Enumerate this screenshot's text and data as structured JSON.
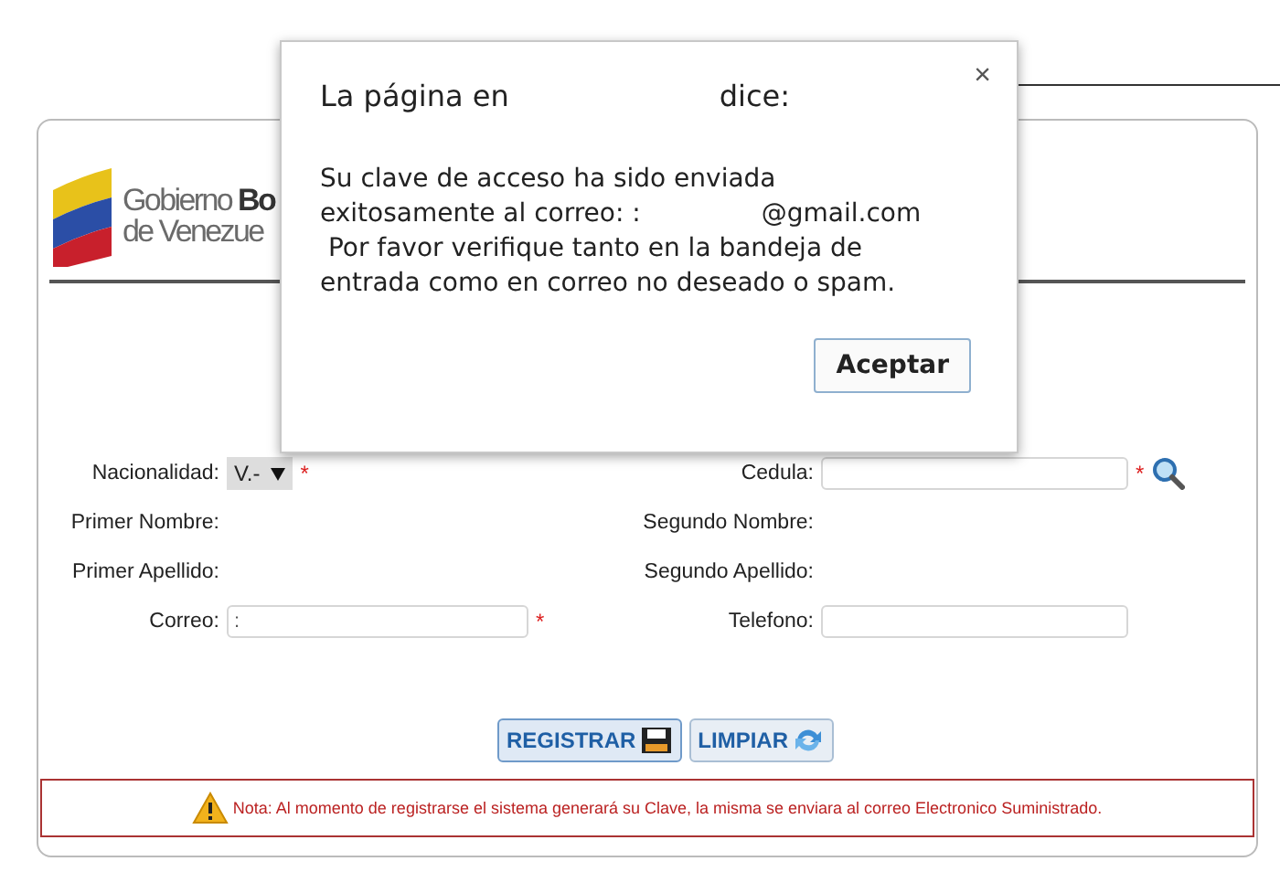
{
  "page": {
    "logo": {
      "line1": "Gobierno **Bo**",
      "line2": "de Venezue"
    }
  },
  "form": {
    "rows": [
      {
        "left": {
          "label": "Nacionalidad:",
          "kind": "select",
          "value": "V.-",
          "marker": "*"
        },
        "right": {
          "label": "Cedula:",
          "kind": "input",
          "marker": "*",
          "search": true
        }
      },
      {
        "left": {
          "label": "Primer Nombre:",
          "kind": "text"
        },
        "right": {
          "label": "Segundo Nombre:",
          "kind": "text"
        }
      },
      {
        "left": {
          "label": "Primer Apellido:",
          "kind": "text"
        },
        "right": {
          "label": "Segundo Apellido:",
          "kind": "text"
        }
      },
      {
        "left": {
          "label": "Correo:",
          "kind": "input",
          "value": ":",
          "marker": "*"
        },
        "right": {
          "label": "Telefono:",
          "kind": "input"
        }
      }
    ],
    "buttons": [
      {
        "label": "REGISTRAR",
        "kind": "save",
        "selected": true
      },
      {
        "label": "LIMPIAR",
        "kind": "refresh",
        "selected": false
      }
    ],
    "note": "Nota: Al momento de registrarse el sistema generará su Clave, la misma se enviara al correo Electronico Suministrado."
  },
  "dialog": {
    "title_start": "La página en",
    "title_end": "dice:",
    "close": "×",
    "message": [
      {
        "text": "Su clave de acceso ha sido enviada"
      },
      {
        "text": "exitosamente al correo: :",
        "suffix": "@gmail.com"
      },
      {
        "text": " Por favor verifique tanto en la bandeja de"
      },
      {
        "text": "entrada como en correo no deseado o spam."
      }
    ],
    "button": "Aceptar"
  }
}
